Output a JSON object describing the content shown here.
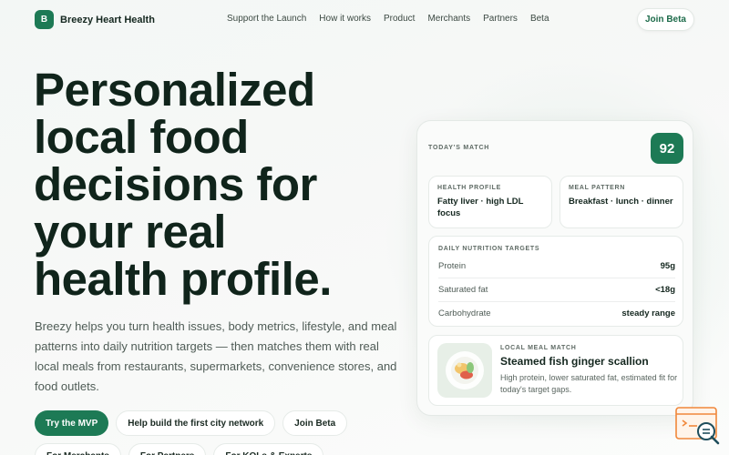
{
  "brand": {
    "logo_letter": "B",
    "name": "Breezy Heart Health"
  },
  "nav": {
    "links": [
      "Support the Launch",
      "How it works",
      "Product",
      "Merchants",
      "Partners",
      "Beta"
    ],
    "join_label": "Join Beta"
  },
  "hero": {
    "title_lines": [
      "Personalized",
      "local food",
      "decisions for",
      "your real",
      "health profile."
    ],
    "description": "Breezy helps you turn health issues, body metrics, lifestyle, and meal patterns into daily nutrition targets — then matches them with real local meals from restaurants, supermarkets, convenience stores, and food outlets.",
    "cta_primary": "Try the MVP",
    "cta_secondary": "Help build the first city network",
    "cta_join": "Join Beta",
    "cta_row2": [
      "For Merchants",
      "For Partners",
      "For KOLs & Experts"
    ]
  },
  "card": {
    "label": "TODAY'S MATCH",
    "score": "92",
    "health_profile": {
      "label": "HEALTH PROFILE",
      "value": "Fatty liver · high LDL focus"
    },
    "meal_pattern": {
      "label": "MEAL PATTERN",
      "value": "Breakfast · lunch · dinner"
    },
    "targets": {
      "label": "DAILY NUTRITION TARGETS",
      "rows": [
        {
          "name": "Protein",
          "value": "95g"
        },
        {
          "name": "Saturated fat",
          "value": "<18g"
        },
        {
          "name": "Carbohydrate",
          "value": "steady range"
        }
      ]
    },
    "meal": {
      "label": "LOCAL MEAL MATCH",
      "title": "Steamed fish ginger scallion",
      "description": "High protein, lower saturated fat, estimated fit for today's target gaps."
    }
  },
  "colors": {
    "accent": "#1d7a55",
    "background": "#f5f8f6",
    "text": "#10241b",
    "widget": "#f0873a"
  },
  "icons": {
    "widget": "chat-help-icon",
    "meal": "food-bowl-icon"
  }
}
